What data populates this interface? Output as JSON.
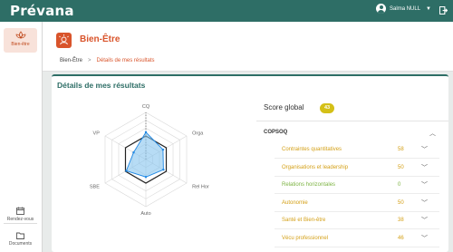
{
  "app": {
    "name": "Prévana"
  },
  "user": {
    "name": "Salma NULL"
  },
  "sidebar": {
    "items": [
      {
        "label": "Bien-être",
        "icon": "lotus-icon"
      },
      {
        "label": "Rendez-vous",
        "icon": "calendar-icon"
      },
      {
        "label": "Documents",
        "icon": "folder-icon"
      }
    ]
  },
  "section": {
    "title": "Bien-Être",
    "icon": "wellbeing-icon"
  },
  "breadcrumb": {
    "root": "Bien-Être",
    "current": "Détails de mes résultats"
  },
  "card": {
    "title": "Détails de mes résultats"
  },
  "score": {
    "label": "Score global",
    "value": "43",
    "color": "#d4c017"
  },
  "group": {
    "label": "COPSOQ"
  },
  "results": [
    {
      "label": "Contraintes quantitatives",
      "value": "58",
      "color": "#d4a017"
    },
    {
      "label": "Organisations et leadership",
      "value": "50",
      "color": "#d4a017"
    },
    {
      "label": "Relations horizontales",
      "value": "0",
      "color": "#7cb342"
    },
    {
      "label": "Autonomie",
      "value": "50",
      "color": "#d4a017"
    },
    {
      "label": "Santé et Bien-être",
      "value": "38",
      "color": "#d4a017"
    },
    {
      "label": "Vécu professionnel",
      "value": "46",
      "color": "#d4a017"
    }
  ],
  "chart_data": {
    "type": "radar",
    "axes": [
      "CQ",
      "Orga",
      "Rel Hor",
      "Auto",
      "SBE",
      "VP"
    ],
    "rings": 6,
    "series": [
      {
        "values": [
          0.5,
          0.5,
          0.5,
          0.5,
          0.5,
          0.5
        ],
        "color": "#222222"
      },
      {
        "values": [
          0.58,
          0.42,
          0.43,
          0.37,
          0.48,
          0.3
        ],
        "color": "#1e88e5"
      }
    ]
  }
}
